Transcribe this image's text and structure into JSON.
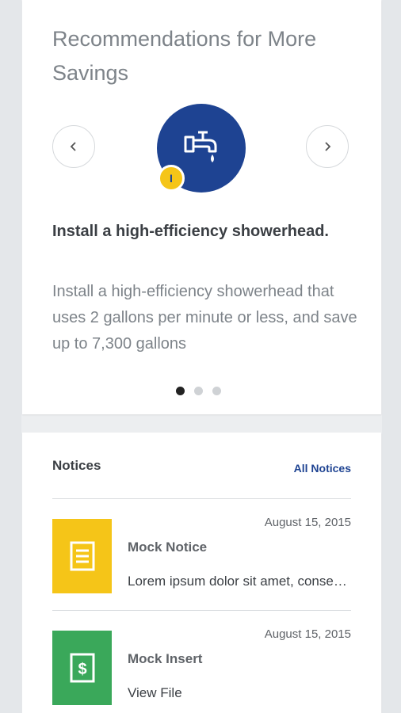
{
  "recommendations": {
    "title": "Recommendations for More Savings",
    "badge": "I",
    "heading": "Install a high-efficiency showerhead.",
    "body": "Install a high-efficiency showerhead that uses 2 gallons per minute or less, and save up to 7,300 gallons",
    "icon": "faucet-icon",
    "page_count": 3,
    "active_page": 1,
    "colors": {
      "icon_bg": "#1e4392",
      "badge_bg": "#f5c518"
    }
  },
  "notices": {
    "title": "Notices",
    "all_link": "All Notices",
    "items": [
      {
        "date": "August 15, 2015",
        "name": "Mock Notice",
        "description": "Lorem ipsum dolor sit amet, consectetur",
        "icon": "document-icon",
        "color": "#f5c518"
      },
      {
        "date": "August 15, 2015",
        "name": "Mock Insert",
        "description": "View File",
        "icon": "dollar-document-icon",
        "color": "#3aa85a"
      }
    ]
  }
}
